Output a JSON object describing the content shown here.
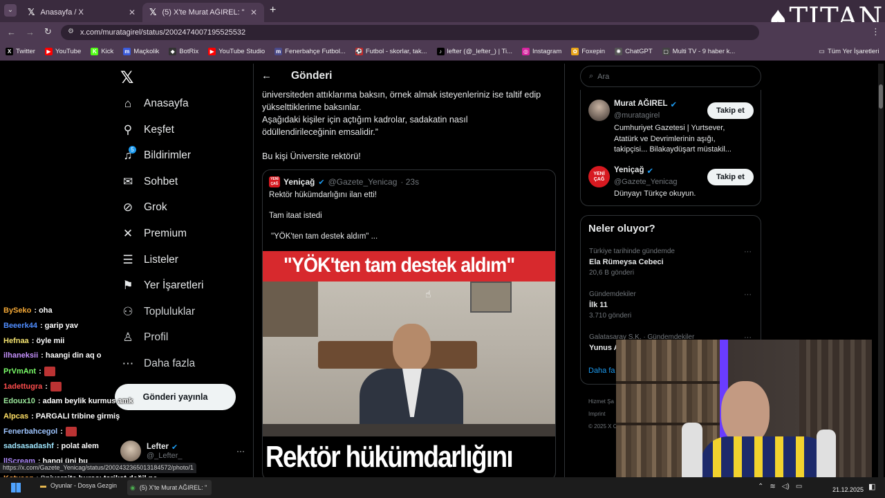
{
  "browser": {
    "tabs": [
      {
        "title": "Anasayfa / X"
      },
      {
        "title": "(5) X'te Murat AĞIREL: \"\"Bana s"
      }
    ],
    "url": "x.com/muratagirel/status/2002474007195525532",
    "bookmarks": [
      {
        "label": "Twitter",
        "color": "#000000",
        "glyph": "X"
      },
      {
        "label": "YouTube",
        "color": "#ff0000",
        "glyph": "▶"
      },
      {
        "label": "Kick",
        "color": "#53fc18",
        "glyph": "K"
      },
      {
        "label": "Maçkolik",
        "color": "#3b5bdb",
        "glyph": "m"
      },
      {
        "label": "BotRix",
        "color": "#333333",
        "glyph": "◆"
      },
      {
        "label": "YouTube Studio",
        "color": "#ff0000",
        "glyph": "▶"
      },
      {
        "label": "Fenerbahçe Futbol...",
        "color": "#4a4a8a",
        "glyph": "m"
      },
      {
        "label": "Futbol - skorlar, tak...",
        "color": "#c62828",
        "glyph": "⚽"
      },
      {
        "label": "lefter (@_lefter_) | Ti...",
        "color": "#000000",
        "glyph": "♪"
      },
      {
        "label": "Instagram",
        "color": "#d6249f",
        "glyph": "◎"
      },
      {
        "label": "Foxepin",
        "color": "#e8a317",
        "glyph": "✿"
      },
      {
        "label": "ChatGPT",
        "color": "#555555",
        "glyph": "✺"
      },
      {
        "label": "Multi TV - 9 haber k...",
        "color": "#444444",
        "glyph": "▢"
      }
    ],
    "all_bookmarks": "Tüm Yer İşaretleri"
  },
  "overlay_logo": "TITAN",
  "nav": {
    "items": [
      {
        "label": "Anasayfa",
        "icon": "home-icon"
      },
      {
        "label": "Keşfet",
        "icon": "search-icon"
      },
      {
        "label": "Bildirimler",
        "icon": "bell-icon",
        "badge": "5"
      },
      {
        "label": "Sohbet",
        "icon": "mail-icon"
      },
      {
        "label": "Grok",
        "icon": "grok-icon"
      },
      {
        "label": "Premium",
        "icon": "x-icon"
      },
      {
        "label": "Listeler",
        "icon": "list-icon"
      },
      {
        "label": "Yer İşaretleri",
        "icon": "bookmark-icon"
      },
      {
        "label": "Topluluklar",
        "icon": "people-icon"
      },
      {
        "label": "Profil",
        "icon": "person-icon"
      },
      {
        "label": "Daha fazla",
        "icon": "more-icon"
      }
    ],
    "post_button": "Gönderi yayınla",
    "account": {
      "name": "Lefter",
      "handle": "@_Lefter_"
    }
  },
  "header": {
    "title": "Gönderi"
  },
  "post": {
    "lines": [
      "üniversiteden attıklarıma baksın, örnek almak isteyenleriniz ise taltif edip",
      "yükselttiklerime baksınlar.",
      "Aşağıdaki kişiler için açtığım kadrolar, sadakatin nasıl",
      "ödüllendirileceğinin emsalidir.”"
    ],
    "footer": "Bu kişi Üniversite rektörü!"
  },
  "quote": {
    "name": "Yeniçağ",
    "handle": "@Gazete_Yenicag",
    "time": "· 23s",
    "avatar_text": "YENİ ÇAĞ",
    "line1": "Rektör hükümdarlığını ilan etti!",
    "line2": "Tam itaat istedi",
    "line3": "\"YÖK'ten tam destek aldım\" ...",
    "image_banner": "\"YÖK'ten tam destek aldım\"",
    "image_bottom": "Rektör hükümdarlığını"
  },
  "search": {
    "placeholder": "Ara"
  },
  "suggestions": [
    {
      "name": "Murat AĞIREL",
      "handle": "@muratagirel",
      "bio": "Cumhuriyet Gazetesi | Yurtsever, Atatürk ve Devrimlerinin aşığı, takipçisi... Bilakaydüşart müstakil...",
      "button": "Takip et"
    },
    {
      "name": "Yeniçağ",
      "handle": "@Gazete_Yenicag",
      "bio": "Dünyayı Türkçe okuyun.",
      "button": "Takip et"
    }
  ],
  "trends": {
    "title": "Neler oluyor?",
    "items": [
      {
        "context": "Türkiye tarihinde gündemde",
        "name": "Ela Rümeysa Cebeci",
        "count": "20,6 B gönderi"
      },
      {
        "context": "Gündemdekiler",
        "name": "İlk 11",
        "count": "3.710 gönderi"
      },
      {
        "context": "Galatasaray S.K. · Gündemdekiler",
        "name": "Yunus A",
        "count": ""
      }
    ],
    "more": "Daha fa"
  },
  "footer_links": [
    "Hizmet Şa",
    "Imprint",
    "© 2025 X C"
  ],
  "status_url": "https://x.com/Gazete_Yenicag/status/2002432365013184572/photo/1",
  "chat": [
    {
      "user": "BySeko",
      "msg": ": oha",
      "color": "#f4a836"
    },
    {
      "user": "Beeerk44",
      "msg": ": garip yav",
      "color": "#4f8dff"
    },
    {
      "user": "Hefnaa",
      "msg": ": öyle mii",
      "color": "#f4e36f"
    },
    {
      "user": "ilhaneksii",
      "msg": ": haangi din aq o",
      "color": "#c792ff"
    },
    {
      "user": "PrVmAnt",
      "msg": ":",
      "color": "#7cff6a"
    },
    {
      "user": "1adettugra",
      "msg": ":",
      "color": "#ff4d4d"
    },
    {
      "user": "Edoux10",
      "msg": ": adam beylik kurmus amk",
      "color": "#9be89b"
    },
    {
      "user": "Alpcas",
      "msg": ": PARGALI tribine girmiş",
      "color": "#ffe066"
    },
    {
      "user": "Fenerbahcegol",
      "msg": ":",
      "color": "#9ec5ff"
    },
    {
      "user": "sadsasadashf",
      "msg": ": polat alem",
      "color": "#a0e7ff"
    },
    {
      "user": "llScream",
      "msg": ": hangi üni bu",
      "color": "#b18cff"
    },
    {
      "user": "Kotyaon",
      "msg": ": üniversite burası tarikat değil ne hallere düştük ya",
      "color": "#ffa94d"
    }
  ],
  "taskbar": {
    "apps": [
      "Oyunlar - Dosya Gezgin",
      "(5) X'te Murat AĞIREL: \""
    ],
    "date": "21.12.2025"
  }
}
